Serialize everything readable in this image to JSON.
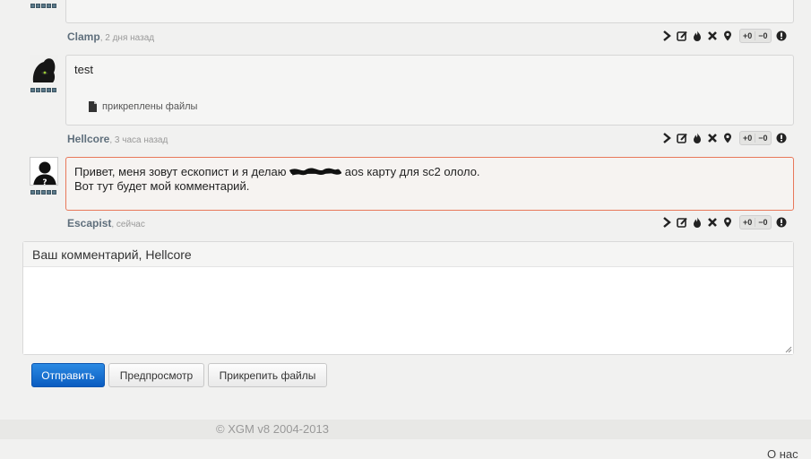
{
  "comments": [
    {
      "author": "Clamp",
      "time": ", 2 дня назад",
      "text": ""
    },
    {
      "author": "Hellcore",
      "time": ", 3 часа назад",
      "text": "test",
      "attachment_label": "прикреплены файлы"
    },
    {
      "author": "Escapist",
      "time": ", сейчас",
      "line1_before": "Привет, меня зовут ескопист и я делаю",
      "line1_after": "aos карту для sc2 ололо.",
      "line2": "Вот тут будет мой комментарий."
    }
  ],
  "votes": {
    "plus": "+0",
    "minus": "−0"
  },
  "form": {
    "heading_prefix": "Ваш комментарий,",
    "heading_user": "Hellcore",
    "textarea_value": "",
    "submit_label": "Отправить",
    "preview_label": "Предпросмотр",
    "attach_label": "Прикрепить файлы"
  },
  "footer": {
    "copyright": "© XGM v8 2004-2013",
    "about_link": "О нас"
  },
  "icons": [
    "reply-icon",
    "edit-icon",
    "fire-icon",
    "delete-icon",
    "pin-icon",
    "report-icon",
    "file-icon"
  ],
  "colors": {
    "highlight_border": "#e8785a",
    "primary_button": "#1a72d4",
    "author": "#5f6f7c"
  }
}
